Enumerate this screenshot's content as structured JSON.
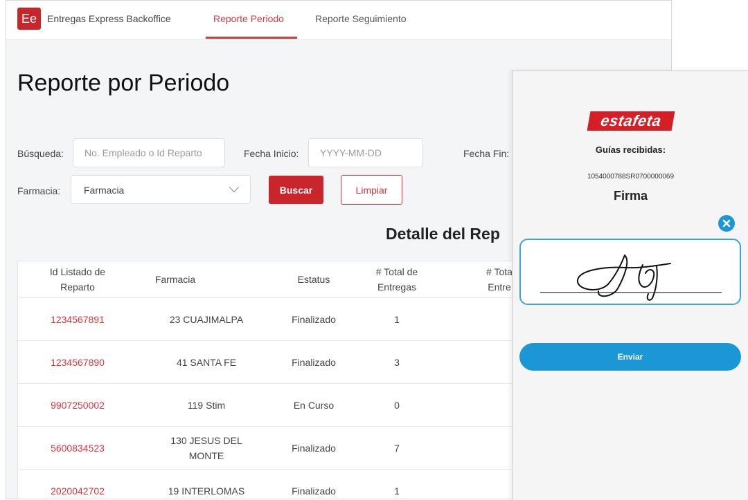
{
  "app": {
    "logo_text": "Ee",
    "title": "Entregas Express Backoffice",
    "nav": [
      {
        "label": "Reporte Periodo",
        "active": true
      },
      {
        "label": "Reporte Seguimiento",
        "active": false
      }
    ],
    "accent_color": "#d9363e"
  },
  "page": {
    "title": "Reporte por Periodo"
  },
  "filters": {
    "search_label": "Búsqueda:",
    "search_placeholder": "No. Empleado o Id Reparto",
    "start_label": "Fecha Inicio:",
    "start_placeholder": "YYYY-MM-DD",
    "end_label": "Fecha Fin:",
    "pharmacy_label": "Farmacia:",
    "pharmacy_value": "Farmacia",
    "search_button": "Buscar",
    "clear_button": "Limpiar"
  },
  "report": {
    "section_title": "Detalle del Rep",
    "columns": [
      "Id Listado de Reparto",
      "Farmacia",
      "Estatus",
      "# Total de Entregas",
      "# Tota Entre"
    ],
    "rows": [
      {
        "id": "1234567891",
        "pharmacy": "23 CUAJIMALPA",
        "status": "Finalizado",
        "total": "1"
      },
      {
        "id": "1234567890",
        "pharmacy": "41 SANTA FE",
        "status": "Finalizado",
        "total": "3"
      },
      {
        "id": "9907250002",
        "pharmacy": "119 Stim",
        "status": "En Curso",
        "total": "0"
      },
      {
        "id": "5600834523",
        "pharmacy": "130 JESUS DEL MONTE",
        "status": "Finalizado",
        "total": "7"
      },
      {
        "id": "2020042702",
        "pharmacy": "19 INTERLOMAS",
        "status": "Finalizado",
        "total": "1"
      }
    ]
  },
  "signature": {
    "brand": "estafeta",
    "brand_color": "#d41f26",
    "guias_label": "Guías recibidas:",
    "guia_number": "1054000788SR0700000069",
    "firma_label": "Firma",
    "send_button": "Enviar",
    "button_color": "#1c97d6"
  }
}
